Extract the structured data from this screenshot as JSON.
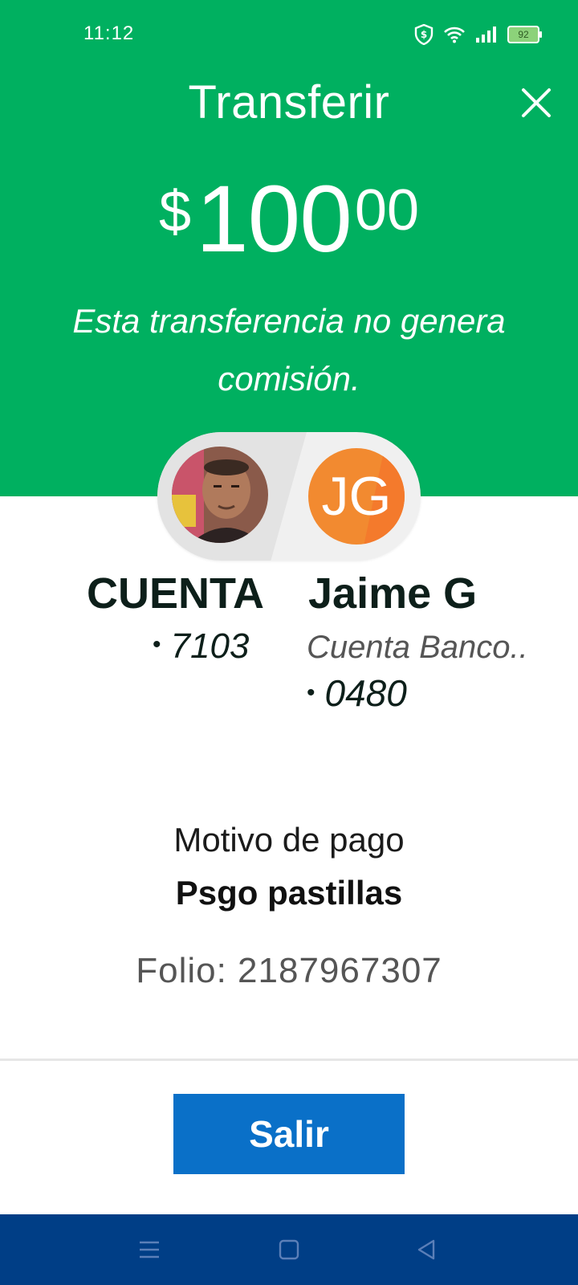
{
  "status_bar": {
    "time": "11:12",
    "battery": "92",
    "icons": [
      "shield-icon",
      "wifi-icon",
      "signal-icon",
      "battery-icon"
    ]
  },
  "header": {
    "title": "Transferir",
    "close_icon": "close-icon",
    "background_color": "#00b060"
  },
  "amount": {
    "currency": "$",
    "integer": "100",
    "decimals": "00"
  },
  "commission_note": "Esta transferencia no genera comisión.",
  "origin": {
    "name": "CUENTA",
    "account": "7103",
    "avatar": "profile-photo"
  },
  "destination": {
    "initials": "JG",
    "name": "Jaime G",
    "bank": "Cuenta Banco..",
    "account": "0480",
    "avatar_color": "#f28a30"
  },
  "details": {
    "motivo_label": "Motivo de pago",
    "motivo_value": "Psgo pastillas",
    "folio": "Folio: 2187967307"
  },
  "actions": {
    "exit_label": "Salir",
    "button_color": "#0a70c8"
  },
  "nav_bar": {
    "buttons": [
      "menu-icon",
      "home-icon",
      "back-icon"
    ],
    "background_color": "#003e86"
  }
}
